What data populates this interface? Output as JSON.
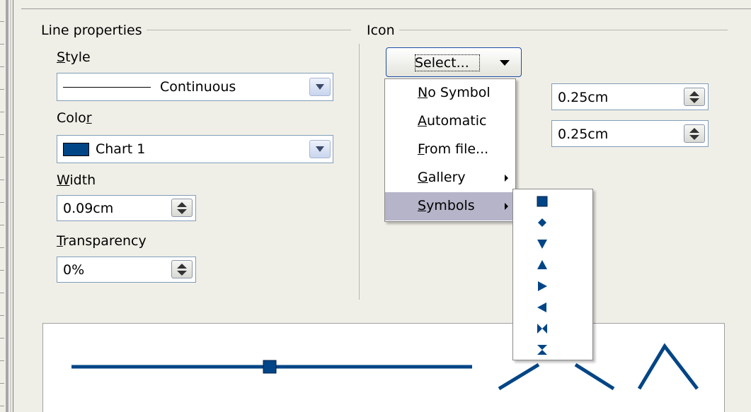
{
  "line_properties": {
    "title": "Line properties",
    "style": {
      "label_prefix": "",
      "label_mnemonic": "S",
      "label_rest": "tyle",
      "value": "Continuous"
    },
    "color": {
      "label_prefix": "Colo",
      "label_mnemonic": "r",
      "label_rest": "",
      "value": "Chart 1",
      "swatch": "#004586"
    },
    "width": {
      "label_prefix": "",
      "label_mnemonic": "W",
      "label_rest": "idth",
      "value": "0.09cm"
    },
    "transparency": {
      "label_prefix": "",
      "label_mnemonic": "T",
      "label_rest": "ransparency",
      "value": "0%"
    }
  },
  "icon": {
    "title": "Icon",
    "select_label": "Select...",
    "width_value": "0.25cm",
    "height_value": "0.25cm"
  },
  "select_menu": {
    "items": [
      {
        "prefix": "",
        "mnemonic": "N",
        "rest": "o Symbol"
      },
      {
        "prefix": "",
        "mnemonic": "A",
        "rest": "utomatic"
      },
      {
        "prefix": "",
        "mnemonic": "F",
        "rest": "rom file..."
      },
      {
        "prefix": "",
        "mnemonic": "G",
        "rest": "allery"
      },
      {
        "prefix": "",
        "mnemonic": "S",
        "rest": "ymbols"
      }
    ]
  },
  "symbols_menu": {
    "icons": [
      "square-icon",
      "diamond-icon",
      "triangle-down-icon",
      "triangle-up-icon",
      "triangle-right-icon",
      "triangle-left-icon",
      "bowtie-icon",
      "hourglass-icon"
    ]
  },
  "colors": {
    "accent": "#004586",
    "menu_highlight": "#b5b4c9",
    "dialog_bg": "#f0efe7"
  }
}
